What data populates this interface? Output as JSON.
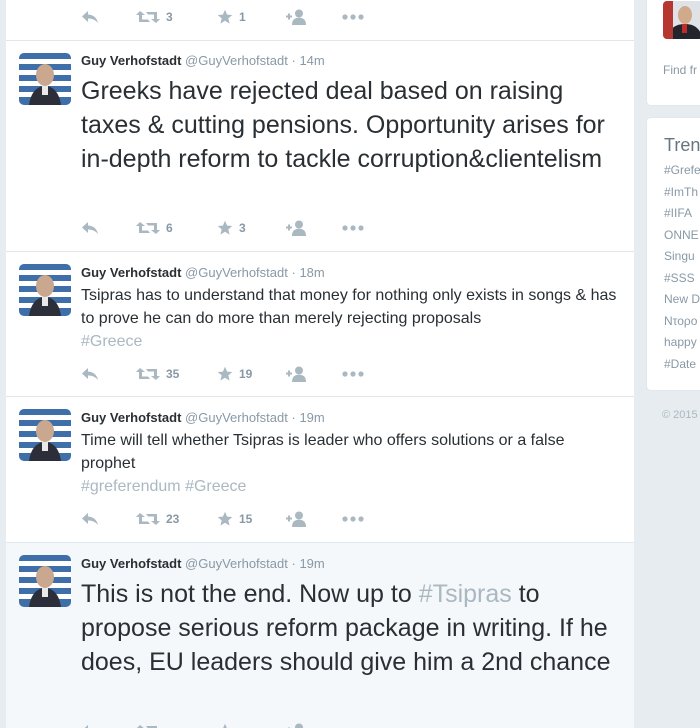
{
  "tweet0": {
    "retweets": "3",
    "favorites": "1"
  },
  "tweets": [
    {
      "fullname": "Guy Verhofstadt",
      "handle": "@GuyVerhofstadt",
      "time": "14m",
      "text": [
        "Greeks have rejected deal based on raising taxes & cutting pensions. Opportunity arises for in-depth reform to tackle corruption&clientelism"
      ],
      "retweets": "6",
      "favorites": "3"
    },
    {
      "fullname": "Guy Verhofstadt",
      "handle": "@GuyVerhofstadt",
      "time": "18m",
      "text": [
        "Tsipras has to understand that money for nothing only exists in songs & has to prove he can do more than merely rejecting proposals"
      ],
      "hashtags": [
        "#Greece"
      ],
      "retweets": "35",
      "favorites": "19"
    },
    {
      "fullname": "Guy Verhofstadt",
      "handle": "@GuyVerhofstadt",
      "time": "19m",
      "text": [
        "Time will tell whether Tsipras is leader who offers solutions or a false prophet"
      ],
      "hashtags": [
        "#greferendum",
        "#Greece"
      ],
      "retweets": "23",
      "favorites": "15"
    },
    {
      "fullname": "Guy Verhofstadt",
      "handle": "@GuyVerhofstadt",
      "time": "19m",
      "text_before": "This is not the end. Now up to ",
      "hashtag": "#Tsipras",
      "text_after": " to propose serious reform package in writing. If he does, EU leaders should give him a 2nd chance"
    }
  ],
  "sidebar": {
    "find_friends": "Find fr",
    "trends_title": "Tren",
    "trends": [
      "#Grefe",
      "#ImTh",
      "#IIFA",
      "ONNE",
      "Singu",
      "#SSS",
      "New D",
      "Ντορο",
      "happy",
      "#Date"
    ],
    "copyright": "© 2015"
  },
  "colors": {
    "background": "#e6ecf0",
    "hashtag": "#aab8c2",
    "action_icon": "#aab8c2",
    "highlight_row": "#f5f8fa"
  },
  "icons": [
    "reply-icon",
    "retweet-icon",
    "favorite-star-icon",
    "follow-icon",
    "more-icon"
  ]
}
